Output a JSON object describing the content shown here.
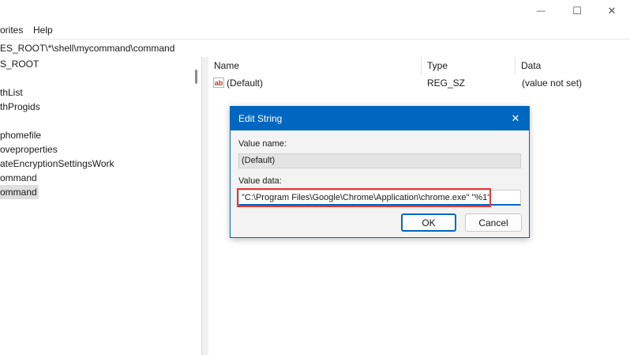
{
  "window": {
    "controls": {
      "minimize": "—",
      "maximize": "☐",
      "close": "✕"
    }
  },
  "menubar": {
    "items": [
      {
        "label": "orites"
      },
      {
        "label": "Help"
      }
    ]
  },
  "address": {
    "path": "ES_ROOT\\*\\shell\\mycommand\\command"
  },
  "tree": {
    "items": [
      {
        "label": "S_ROOT",
        "selected": false
      },
      {
        "label": "thList",
        "selected": false
      },
      {
        "label": "thProgids",
        "selected": false
      },
      {
        "label": "phomefile",
        "selected": false
      },
      {
        "label": "oveproperties",
        "selected": false
      },
      {
        "label": "ateEncryptionSettingsWork",
        "selected": false
      },
      {
        "label": "ommand",
        "selected": false
      },
      {
        "label": "ommand",
        "selected": true
      }
    ]
  },
  "values_table": {
    "columns": [
      "Name",
      "Type",
      "Data"
    ],
    "rows": [
      {
        "icon": "ab",
        "name": "(Default)",
        "type": "REG_SZ",
        "data": "(value not set)"
      }
    ]
  },
  "dialog": {
    "title": "Edit String",
    "close_glyph": "✕",
    "value_name_label": "Value name:",
    "value_name": "(Default)",
    "value_data_label": "Value data:",
    "value_data": "\"C:\\Program Files\\Google\\Chrome\\Application\\chrome.exe\" \"%1\"",
    "ok_label": "OK",
    "cancel_label": "Cancel",
    "accent_color": "#0067c0",
    "highlight_color": "#e53935"
  }
}
